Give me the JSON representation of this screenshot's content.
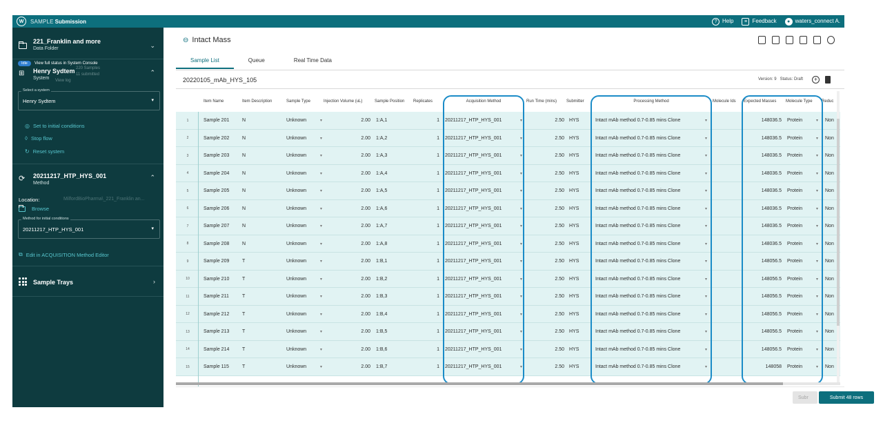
{
  "topbar": {
    "brand_a": "SAMPLE",
    "brand_b": "Submission",
    "help": "Help",
    "feedback": "Feedback",
    "user": "waters_connect A."
  },
  "sidebar": {
    "folder": {
      "title": "221_Franklin and more",
      "subtitle": "Data Folder"
    },
    "system": {
      "badge": "Idle",
      "tooltip": "View full status in System Console",
      "title": "Henry Sydtem",
      "subtitle": "System",
      "select_label": "Select a system",
      "select_value": "Henry Sydtem",
      "ghost_line1": "220 Samples",
      "ghost_line2": "11 submitted",
      "ghost_line3": "View log"
    },
    "actions": [
      "Set to initial conditions",
      "Stop flow",
      "Reset system"
    ],
    "method": {
      "title": "20211217_HTP_HYS_001",
      "subtitle": "Method",
      "location_label": "Location:",
      "location_value": "MilfordBioPharma\\_221_Franklin an...",
      "browse": "Browse",
      "select_label": "Method for initial conditions",
      "select_value": "20211217_HTP_HYS_001",
      "edit_link": "Edit in ACQUISITION Method Editor"
    },
    "trays": {
      "title": "Sample Trays"
    }
  },
  "main": {
    "title": "Intact Mass",
    "tabs": [
      "Sample List",
      "Queue",
      "Real Time Data"
    ],
    "list_name": "20220105_mAb_HYS_105",
    "version": "Version: 9",
    "status": "Status: Draft",
    "columns": [
      "Item Name",
      "Item Description",
      "Sample Type",
      "Injection Volume (uL)",
      "Sample Position",
      "Replicates",
      "Acquisition Method",
      "Run Time (mins)",
      "Submitter",
      "Processing Method",
      "Molecule Ids",
      "Expected Masses",
      "Molecule Type",
      "Reduc"
    ],
    "rows": [
      {
        "n": "1",
        "name": "Sample 201",
        "desc": "N",
        "type": "Unknown",
        "vol": "2.00",
        "pos": "1:A,1",
        "rep": "1",
        "acq": "20211217_HTP_HYS_001",
        "rt": "2.50",
        "sub": "HYS",
        "proc": "Intact mAb method 0.7-0.85 mins Clone",
        "mass": "148036.5",
        "mol": "Protein",
        "red": "Non"
      },
      {
        "n": "2",
        "name": "Sample 202",
        "desc": "N",
        "type": "Unknown",
        "vol": "2.00",
        "pos": "1:A,2",
        "rep": "1",
        "acq": "20211217_HTP_HYS_001",
        "rt": "2.50",
        "sub": "HYS",
        "proc": "Intact mAb method 0.7-0.85 mins Clone",
        "mass": "148036.5",
        "mol": "Protein",
        "red": "Non"
      },
      {
        "n": "3",
        "name": "Sample 203",
        "desc": "N",
        "type": "Unknown",
        "vol": "2.00",
        "pos": "1:A,3",
        "rep": "1",
        "acq": "20211217_HTP_HYS_001",
        "rt": "2.50",
        "sub": "HYS",
        "proc": "Intact mAb method 0.7-0.85 mins Clone",
        "mass": "148036.5",
        "mol": "Protein",
        "red": "Non"
      },
      {
        "n": "4",
        "name": "Sample 204",
        "desc": "N",
        "type": "Unknown",
        "vol": "2.00",
        "pos": "1:A,4",
        "rep": "1",
        "acq": "20211217_HTP_HYS_001",
        "rt": "2.50",
        "sub": "HYS",
        "proc": "Intact mAb method 0.7-0.85 mins Clone",
        "mass": "148036.5",
        "mol": "Protein",
        "red": "Non"
      },
      {
        "n": "5",
        "name": "Sample 205",
        "desc": "N",
        "type": "Unknown",
        "vol": "2.00",
        "pos": "1:A,5",
        "rep": "1",
        "acq": "20211217_HTP_HYS_001",
        "rt": "2.50",
        "sub": "HYS",
        "proc": "Intact mAb method 0.7-0.85 mins Clone",
        "mass": "148036.5",
        "mol": "Protein",
        "red": "Non"
      },
      {
        "n": "6",
        "name": "Sample 206",
        "desc": "N",
        "type": "Unknown",
        "vol": "2.00",
        "pos": "1:A,6",
        "rep": "1",
        "acq": "20211217_HTP_HYS_001",
        "rt": "2.50",
        "sub": "HYS",
        "proc": "Intact mAb method 0.7-0.85 mins Clone",
        "mass": "148036.5",
        "mol": "Protein",
        "red": "Non"
      },
      {
        "n": "7",
        "name": "Sample 207",
        "desc": "N",
        "type": "Unknown",
        "vol": "2.00",
        "pos": "1:A,7",
        "rep": "1",
        "acq": "20211217_HTP_HYS_001",
        "rt": "2.50",
        "sub": "HYS",
        "proc": "Intact mAb method 0.7-0.85 mins Clone",
        "mass": "148036.5",
        "mol": "Protein",
        "red": "Non"
      },
      {
        "n": "8",
        "name": "Sample 208",
        "desc": "N",
        "type": "Unknown",
        "vol": "2.00",
        "pos": "1:A,8",
        "rep": "1",
        "acq": "20211217_HTP_HYS_001",
        "rt": "2.50",
        "sub": "HYS",
        "proc": "Intact mAb method 0.7-0.85 mins Clone",
        "mass": "148036.5",
        "mol": "Protein",
        "red": "Non"
      },
      {
        "n": "9",
        "name": "Sample 209",
        "desc": "T",
        "type": "Unknown",
        "vol": "2.00",
        "pos": "1:B,1",
        "rep": "1",
        "acq": "20211217_HTP_HYS_001",
        "rt": "2.50",
        "sub": "HYS",
        "proc": "Intact mAb method 0.7-0.85 mins Clone",
        "mass": "148056.5",
        "mol": "Protein",
        "red": "Non"
      },
      {
        "n": "10",
        "name": "Sample 210",
        "desc": "T",
        "type": "Unknown",
        "vol": "2.00",
        "pos": "1:B,2",
        "rep": "1",
        "acq": "20211217_HTP_HYS_001",
        "rt": "2.50",
        "sub": "HYS",
        "proc": "Intact mAb method 0.7-0.85 mins Clone",
        "mass": "148056.5",
        "mol": "Protein",
        "red": "Non"
      },
      {
        "n": "11",
        "name": "Sample 211",
        "desc": "T",
        "type": "Unknown",
        "vol": "2.00",
        "pos": "1:B,3",
        "rep": "1",
        "acq": "20211217_HTP_HYS_001",
        "rt": "2.50",
        "sub": "HYS",
        "proc": "Intact mAb method 0.7-0.85 mins Clone",
        "mass": "148056.5",
        "mol": "Protein",
        "red": "Non"
      },
      {
        "n": "12",
        "name": "Sample 212",
        "desc": "T",
        "type": "Unknown",
        "vol": "2.00",
        "pos": "1:B,4",
        "rep": "1",
        "acq": "20211217_HTP_HYS_001",
        "rt": "2.50",
        "sub": "HYS",
        "proc": "Intact mAb method 0.7-0.85 mins Clone",
        "mass": "148056.5",
        "mol": "Protein",
        "red": "Non"
      },
      {
        "n": "13",
        "name": "Sample 213",
        "desc": "T",
        "type": "Unknown",
        "vol": "2.00",
        "pos": "1:B,5",
        "rep": "1",
        "acq": "20211217_HTP_HYS_001",
        "rt": "2.50",
        "sub": "HYS",
        "proc": "Intact mAb method 0.7-0.85 mins Clone",
        "mass": "148056.5",
        "mol": "Protein",
        "red": "Non"
      },
      {
        "n": "14",
        "name": "Sample 214",
        "desc": "T",
        "type": "Unknown",
        "vol": "2.00",
        "pos": "1:B,6",
        "rep": "1",
        "acq": "20211217_HTP_HYS_001",
        "rt": "2.50",
        "sub": "HYS",
        "proc": "Intact mAb method 0.7-0.85 mins Clone",
        "mass": "148056.5",
        "mol": "Protein",
        "red": "Non"
      },
      {
        "n": "15",
        "name": "Sample 115",
        "desc": "T",
        "type": "Unknown",
        "vol": "2.00",
        "pos": "1:B,7",
        "rep": "1",
        "acq": "20211217_HTP_HYS_001",
        "rt": "2.50",
        "sub": "HYS",
        "proc": "Intact mAb method 0.7-0.85 mins Clone",
        "mass": "148058",
        "mol": "Protein",
        "red": "Non"
      }
    ]
  },
  "footer": {
    "ghost_button": "Subr",
    "submit_button": "Submit 48 rows"
  },
  "colors": {
    "brand": "#0d6f7d",
    "sidebar": "#0e3b3f",
    "row": "#e1f3f3",
    "highlight": "#1a8bc7",
    "link": "#58c7cf"
  }
}
